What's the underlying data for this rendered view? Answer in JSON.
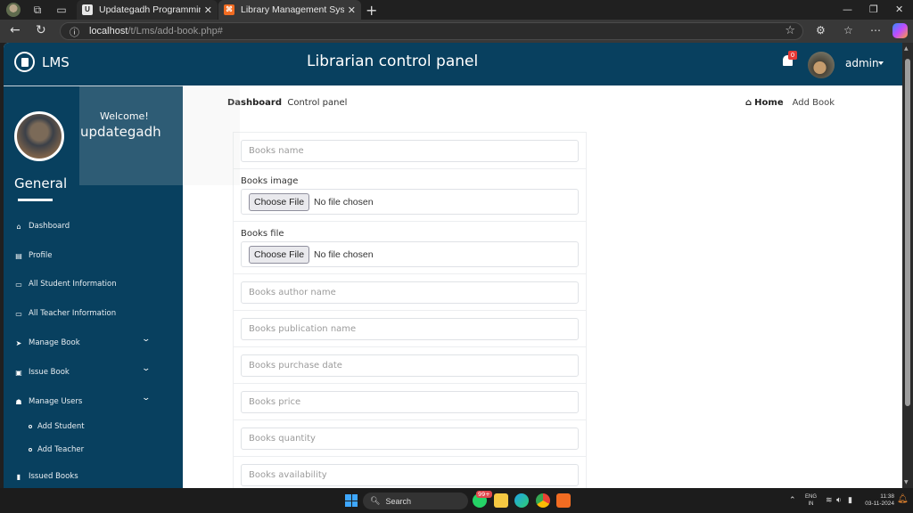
{
  "browser": {
    "tabs": [
      {
        "favicon": "U",
        "title": "Updategadh Programming - Upd",
        "active": false
      },
      {
        "favicon": "⌘",
        "title": "Library Management System",
        "active": true
      }
    ],
    "url_host": "localhost",
    "url_path": "/t/Lms/add-book.php#"
  },
  "header": {
    "brand": "LMS",
    "title": "Librarian control panel",
    "notification_count": "0",
    "user": "admin"
  },
  "sidebar": {
    "welcome": "Welcome!",
    "username": "updategadh",
    "section": "General",
    "items": [
      {
        "icon": "home-icon",
        "glyph": "🏠",
        "label": "Dashboard",
        "expandable": false
      },
      {
        "icon": "id-card-icon",
        "glyph": "▤",
        "label": "Profile",
        "expandable": false
      },
      {
        "icon": "desktop-icon",
        "glyph": "🖵",
        "label": "All Student Information",
        "expandable": false
      },
      {
        "icon": "desktop-icon",
        "glyph": "🖵",
        "label": "All Teacher Information",
        "expandable": false
      },
      {
        "icon": "paper-plane-icon",
        "glyph": "➤",
        "label": "Manage Book",
        "expandable": true
      },
      {
        "icon": "book-icon",
        "glyph": "▣",
        "label": "Issue Book",
        "expandable": true
      },
      {
        "icon": "users-icon",
        "glyph": "👥",
        "label": "Manage Users",
        "expandable": true
      }
    ],
    "sub_items": [
      "Add Student",
      "Add Teacher"
    ],
    "last_item": {
      "icon": "bookmark-icon",
      "label": "Issued Books"
    }
  },
  "content": {
    "breadcrumb_title": "Dashboard",
    "breadcrumb_subtitle": "Control panel",
    "crumb_home": "Home",
    "crumb_current": "Add Book",
    "form": {
      "books_name_placeholder": "Books name",
      "books_image_label": "Books image",
      "books_file_label": "Books file",
      "choose_file": "Choose File",
      "no_file": "No file chosen",
      "author_placeholder": "Books author name",
      "publication_placeholder": "Books publication name",
      "purchase_date_placeholder": "Books purchase date",
      "price_placeholder": "Books price",
      "quantity_placeholder": "Books quantity",
      "availability_placeholder": "Books availability"
    }
  },
  "taskbar": {
    "search": "Search",
    "whatsapp_badge": "99+",
    "lang_top": "ENG",
    "lang_bottom": "IN",
    "time": "11:38",
    "date": "03-11-2024"
  }
}
